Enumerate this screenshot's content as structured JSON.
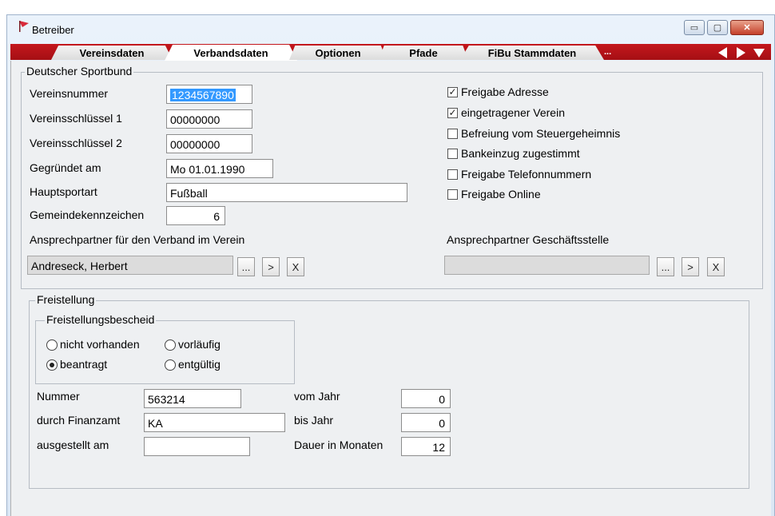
{
  "window": {
    "title": "Betreiber",
    "icon": "app-flag-icon"
  },
  "window_controls": {
    "minimize": "▭",
    "maximize": "▢",
    "close": "✕"
  },
  "tabs": [
    {
      "label": "Vereinsdaten"
    },
    {
      "label": "Verbandsdaten"
    },
    {
      "label": "Optionen"
    },
    {
      "label": "Pfade"
    },
    {
      "label": "FiBu Stammdaten"
    }
  ],
  "tab_more": "...",
  "dsb": {
    "legend": "Deutscher Sportbund",
    "vereinsnummer_label": "Vereinsnummer",
    "vereinsnummer_value": "1234567890",
    "schluessel1_label": "Vereinsschlüssel 1",
    "schluessel1_value": "00000000",
    "schluessel2_label": "Vereinsschlüssel 2",
    "schluessel2_value": "00000000",
    "gegruendet_label": "Gegründet am",
    "gegruendet_value": "Mo 01.01.1990",
    "hauptsportart_label": "Hauptsportart",
    "hauptsportart_value": "Fußball",
    "gemeinde_label": "Gemeindekennzeichen",
    "gemeinde_value": "6",
    "ansprech_verband_label": "Ansprechpartner für den Verband  im Verein",
    "ansprech_verband_value": "Andreseck, Herbert",
    "ansprech_gs_label": "Ansprechpartner  Geschäftsstelle",
    "ansprech_gs_value": "",
    "btn_browse": "...",
    "btn_go": ">",
    "btn_clear": "X",
    "checkboxes": [
      {
        "label": "Freigabe Adresse",
        "checked": true
      },
      {
        "label": "eingetragener Verein",
        "checked": true
      },
      {
        "label": "Befreiung vom Steuergeheimnis",
        "checked": false
      },
      {
        "label": "Bankeinzug zugestimmt",
        "checked": false
      },
      {
        "label": "Freigabe Telefonnummern",
        "checked": false
      },
      {
        "label": "Freigabe Online",
        "checked": false
      }
    ],
    "check_mark": "✓"
  },
  "freistellung": {
    "legend": "Freistellung",
    "bescheid_legend": "Freistellungsbescheid",
    "radios": [
      {
        "label": "nicht vorhanden",
        "selected": false
      },
      {
        "label": "vorläufig",
        "selected": false
      },
      {
        "label": "beantragt",
        "selected": true
      },
      {
        "label": "entgültig",
        "selected": false
      }
    ],
    "nummer_label": "Nummer",
    "nummer_value": "563214",
    "finanzamt_label": "durch Finanzamt",
    "finanzamt_value": "KA",
    "ausgestellt_label": "ausgestellt am",
    "ausgestellt_value": "",
    "vomjahr_label": "vom Jahr",
    "vomjahr_value": "0",
    "bisjahr_label": "bis Jahr",
    "bisjahr_value": "0",
    "dauer_label": "Dauer in Monaten",
    "dauer_value": "12"
  },
  "colors": {
    "tabbar": "#b5121b",
    "selection": "#3399ff",
    "panel": "#eef0f2"
  }
}
